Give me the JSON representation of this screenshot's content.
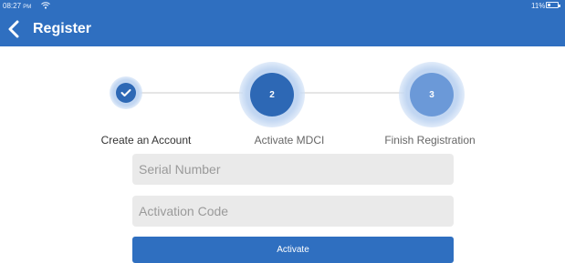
{
  "status_bar": {
    "time": "08:27",
    "ampm": "PM",
    "battery": "11%"
  },
  "header": {
    "title": "Register",
    "back_icon": "chevron-left-icon"
  },
  "steps": [
    {
      "label": "Create an Account",
      "number": "",
      "state": "done",
      "icon": "check-icon"
    },
    {
      "label": "Activate MDCI",
      "number": "2",
      "state": "active"
    },
    {
      "label": "Finish Registration",
      "number": "3",
      "state": "pending"
    }
  ],
  "form": {
    "serial_placeholder": "Serial Number",
    "activation_placeholder": "Activation Code",
    "activate_label": "Activate"
  },
  "colors": {
    "primary": "#2f6fc0",
    "step_active": "#2d68b5",
    "step_pending": "#6b99d8",
    "field_bg": "#eaeaea"
  }
}
